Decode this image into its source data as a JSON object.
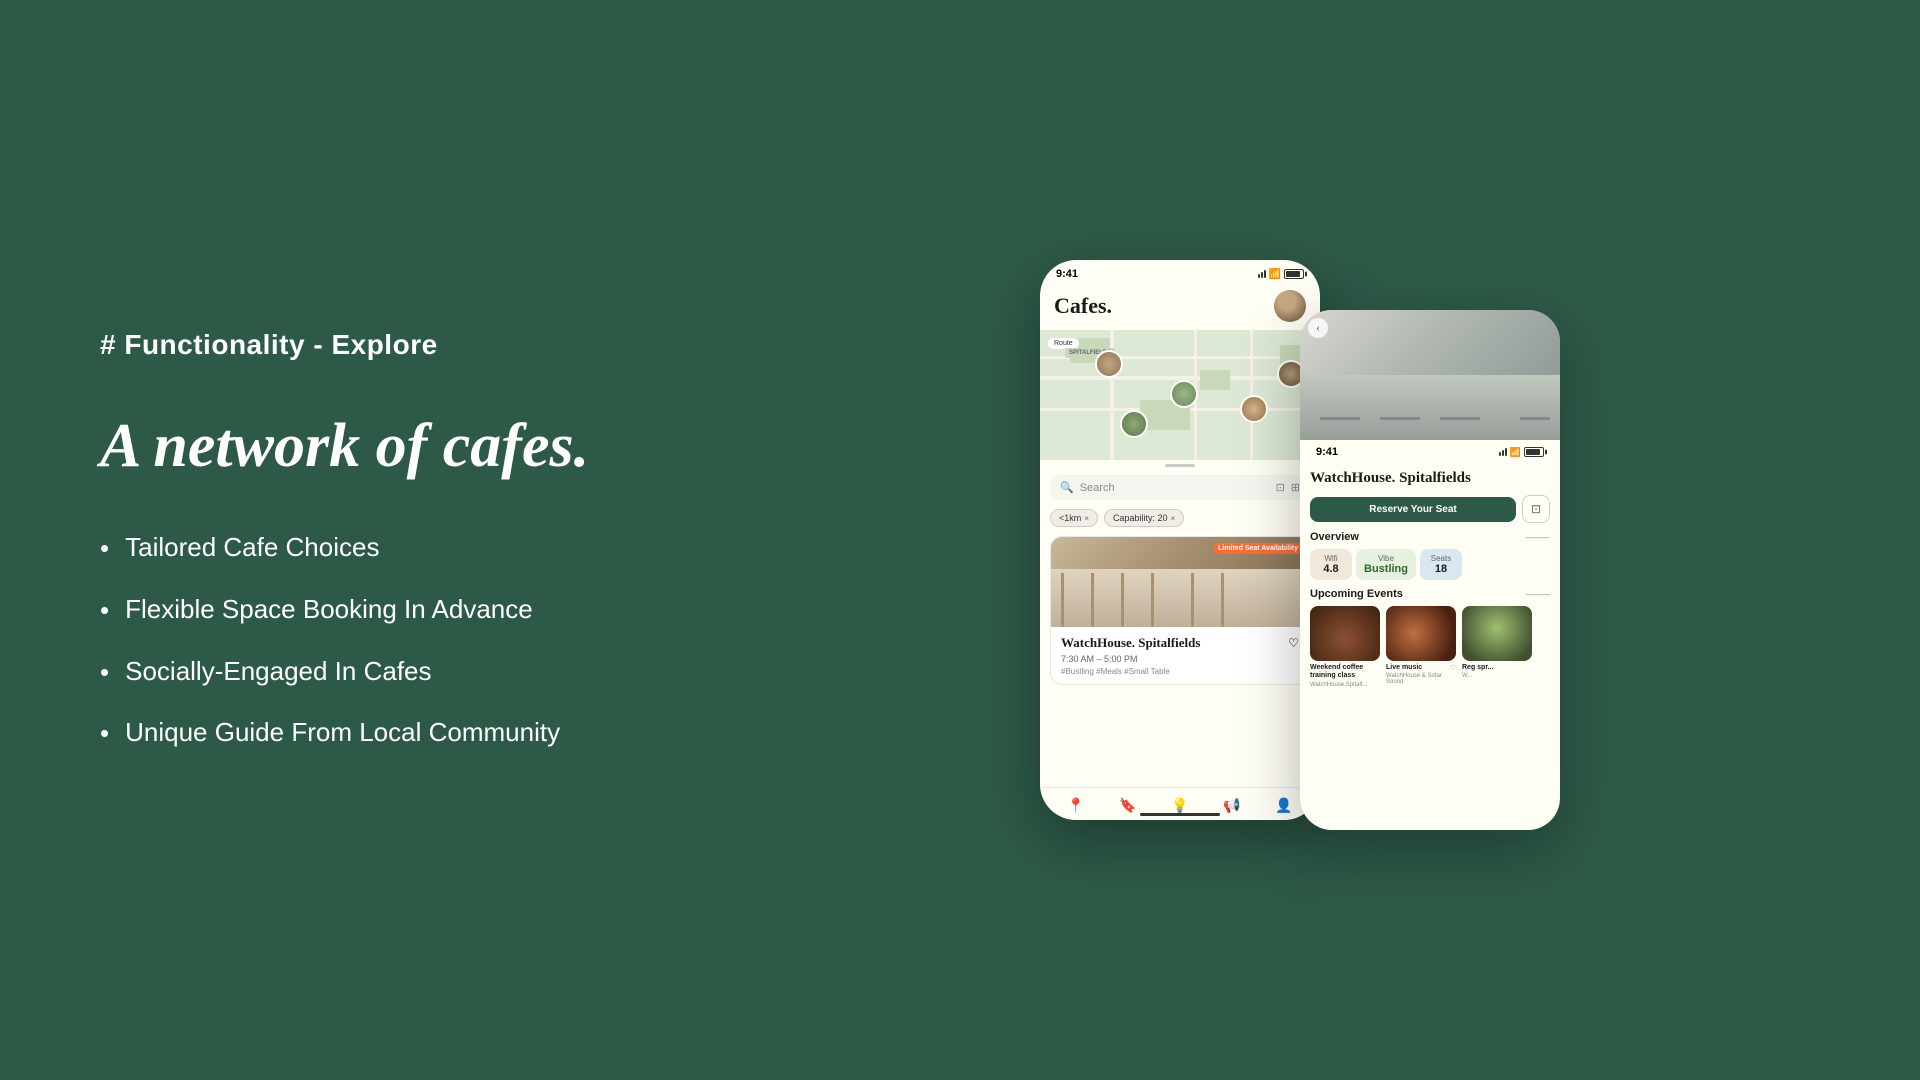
{
  "page": {
    "background_color": "#2d5a47",
    "title": "Functionality - Explore"
  },
  "left": {
    "section_tag": "# Functionality - Explore",
    "main_heading": "A network of cafes.",
    "features": [
      {
        "id": "feature-1",
        "text": "Tailored Cafe Choices"
      },
      {
        "id": "feature-2",
        "text": "Flexible Space Booking In Advance"
      },
      {
        "id": "feature-3",
        "text": "Socially-Engaged In Cafes"
      },
      {
        "id": "feature-4",
        "text": "Unique Guide From Local Community"
      }
    ],
    "bullet": "•"
  },
  "phone1": {
    "status_time": "9:41",
    "title": "Cafes.",
    "map_route_label": "Route",
    "map_spitalfields_label": "SPITALFIELDS",
    "scroll_indicator": true,
    "search_placeholder": "Search",
    "filter_tag_1": "<1km",
    "filter_tag_2": "Capability: 20",
    "cafe_name": "WatchHouse. Spitalfields",
    "cafe_availability": "Limited Seat Availability",
    "cafe_time": "7:30 AM – 5:00 PM",
    "cafe_tags": "#Bustling  #Meals  #Small Table",
    "nav_items": [
      "location",
      "bookmark",
      "bulb",
      "megaphone",
      "person"
    ]
  },
  "phone2": {
    "status_time": "9:41",
    "cafe_name": "WatchHouse. Spitalfields",
    "reserve_btn_label": "Reserve Your Seat",
    "overview_title": "Overview",
    "wifi_label": "Wifi",
    "wifi_value": "4.8",
    "vibe_label": "Vibe",
    "vibe_value": "Bustling",
    "seats_label": "Seats",
    "seats_value": "18",
    "events_title": "Upcoming Events",
    "events": [
      {
        "title": "Weekend coffee training class",
        "subtitle": "WatchHouse.Spitalf...",
        "color": "brown"
      },
      {
        "title": "Live music",
        "subtitle": "WatchHouse & Sofar Sound",
        "color": "orange"
      },
      {
        "title": "Reg spr...",
        "subtitle": "W...",
        "color": "green"
      }
    ]
  },
  "icons": {
    "search": "🔍",
    "calendar": "📅",
    "filter": "⚙",
    "close": "×",
    "bookmark": "♡",
    "location_pin": "📍",
    "bulb": "💡",
    "megaphone": "📢",
    "person": "👤",
    "back": "‹",
    "arrow_right": "→",
    "bookmark_outline": "⊡"
  }
}
